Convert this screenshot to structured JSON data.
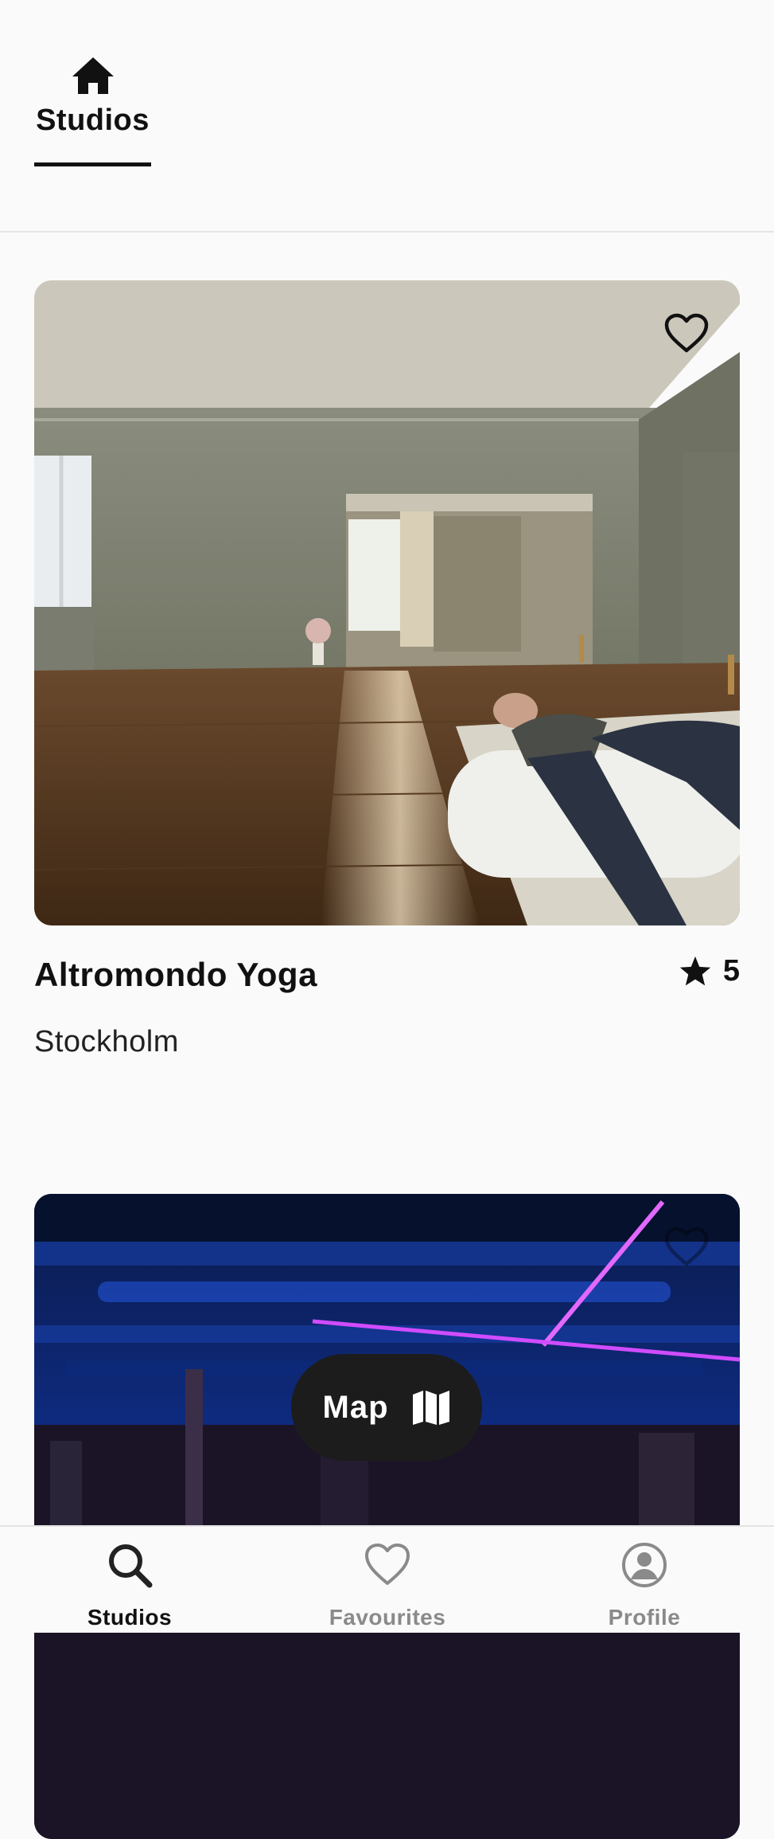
{
  "top_tabs": {
    "active_tab": {
      "label": "Studios",
      "icon": "home-icon"
    }
  },
  "studios": [
    {
      "name": "Altromondo Yoga",
      "location": "Stockholm",
      "rating": "5",
      "favourite_icon": "heart-outline-icon",
      "image": "yoga-studio-photo"
    },
    {
      "image": "gym-studio-photo",
      "favourite_icon": "heart-outline-icon"
    }
  ],
  "map_button": {
    "label": "Map",
    "icon": "map-icon"
  },
  "bottom_nav": {
    "items": [
      {
        "label": "Studios",
        "icon": "search-icon",
        "active": true
      },
      {
        "label": "Favourites",
        "icon": "heart-outline-icon",
        "active": false
      },
      {
        "label": "Profile",
        "icon": "user-circle-icon",
        "active": false
      }
    ]
  },
  "colors": {
    "background": "#fafafa",
    "text": "#111111",
    "inactive": "#8a8a8a",
    "map_button_bg": "#1c1c1c",
    "neon_accent": "#d04cff"
  }
}
